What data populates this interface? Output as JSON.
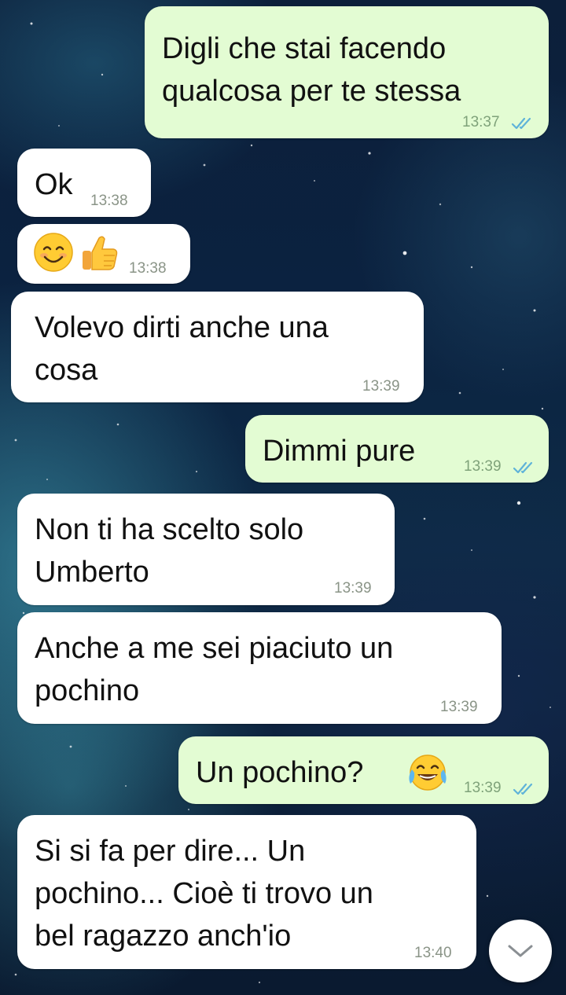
{
  "conversation": {
    "messages": [
      {
        "direction": "outgoing",
        "text": "Digli che stai facendo\nqualcosa per te stessa",
        "time": "13:37",
        "status": "read"
      },
      {
        "direction": "incoming",
        "text": "Ok",
        "time": "13:38"
      },
      {
        "direction": "incoming",
        "emojis": [
          "smiling-face-emoji",
          "thumbs-up-emoji"
        ],
        "time": "13:38"
      },
      {
        "direction": "incoming",
        "text": "Volevo dirti anche una\ncosa",
        "time": "13:39"
      },
      {
        "direction": "outgoing",
        "text": "Dimmi pure",
        "time": "13:39",
        "status": "read"
      },
      {
        "direction": "incoming",
        "text": "Non ti ha scelto solo\nUmberto",
        "time": "13:39"
      },
      {
        "direction": "incoming",
        "text": "Anche a me sei piaciuto un\npochino",
        "time": "13:39"
      },
      {
        "direction": "outgoing",
        "text": "Un pochino?",
        "emoji": "face-with-tears-of-joy-emoji",
        "time": "13:39",
        "status": "read"
      },
      {
        "direction": "incoming",
        "text": "Si si fa per dire... Un\npochino... Cioè ti trovo un\nbel ragazzo anch'io",
        "time": "13:40"
      }
    ]
  },
  "scroll_button": {
    "icon": "chevron-down-icon"
  },
  "colors": {
    "outgoing_bubble": "#e3fcd3",
    "incoming_bubble": "#ffffff",
    "read_ticks": "#5fb3d9",
    "background": "#0b2240"
  }
}
